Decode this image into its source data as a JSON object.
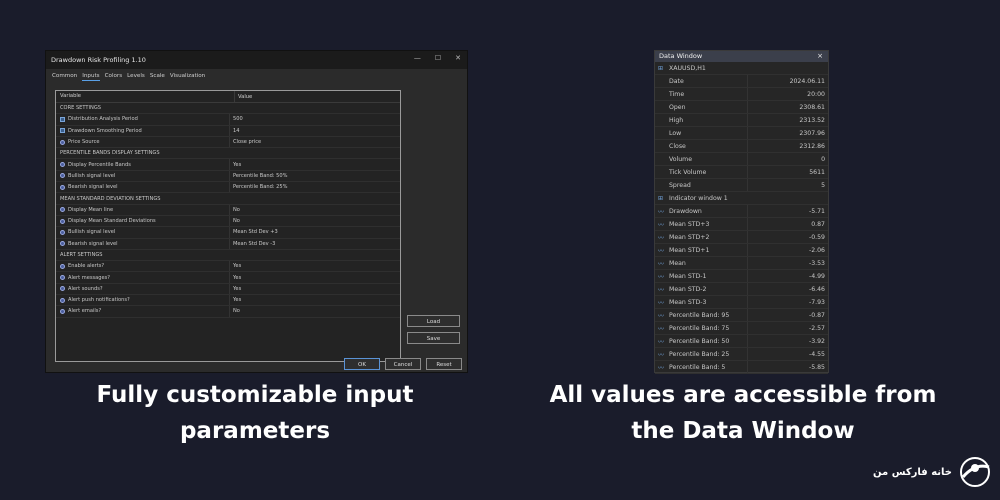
{
  "dialog": {
    "title": "Drawdown Risk Profiling 1.10",
    "tabs": [
      "Common",
      "Inputs",
      "Colors",
      "Levels",
      "Scale",
      "Visualization"
    ],
    "active_tab": "Inputs",
    "headers": {
      "variable": "Variable",
      "value": "Value"
    },
    "rows": [
      {
        "type": "section",
        "label": "CORE SETTINGS"
      },
      {
        "type": "param",
        "icon": "num",
        "label": "Distribution Analysis Period",
        "value": "500"
      },
      {
        "type": "param",
        "icon": "num",
        "label": "Drawdown Smoothing Period",
        "value": "14"
      },
      {
        "type": "param",
        "icon": "opt",
        "label": "Price Source",
        "value": "Close price"
      },
      {
        "type": "section",
        "label": "PERCENTILE BANDS DISPLAY SETTINGS"
      },
      {
        "type": "param",
        "icon": "opt",
        "label": "Display Percentile Bands",
        "value": "Yes"
      },
      {
        "type": "param",
        "icon": "opt",
        "label": "Bullish signal level",
        "value": "Percentile Band: 50%"
      },
      {
        "type": "param",
        "icon": "opt",
        "label": "Bearish signal level",
        "value": "Percentile Band: 25%"
      },
      {
        "type": "section",
        "label": "MEAN STANDARD DEVIATION SETTINGS"
      },
      {
        "type": "param",
        "icon": "opt",
        "label": "Display Mean line",
        "value": "No"
      },
      {
        "type": "param",
        "icon": "opt",
        "label": "Display Mean Standard Deviations",
        "value": "No"
      },
      {
        "type": "param",
        "icon": "opt",
        "label": "Bullish signal level",
        "value": "Mean Std Dev +3"
      },
      {
        "type": "param",
        "icon": "opt",
        "label": "Bearish signal level",
        "value": "Mean Std Dev -3"
      },
      {
        "type": "section",
        "label": "ALERT SETTINGS"
      },
      {
        "type": "param",
        "icon": "opt",
        "label": "Enable alerts?",
        "value": "Yes"
      },
      {
        "type": "param",
        "icon": "opt",
        "label": "Alert messages?",
        "value": "Yes"
      },
      {
        "type": "param",
        "icon": "opt",
        "label": "Alert sounds?",
        "value": "Yes"
      },
      {
        "type": "param",
        "icon": "opt",
        "label": "Alert push notifications?",
        "value": "Yes"
      },
      {
        "type": "param",
        "icon": "opt",
        "label": "Alert emails?",
        "value": "No"
      }
    ],
    "buttons": {
      "load": "Load",
      "save": "Save",
      "ok": "OK",
      "cancel": "Cancel",
      "reset": "Reset"
    }
  },
  "data_window": {
    "title": "Data Window",
    "close": "×",
    "rows": [
      {
        "type": "group",
        "icon": "chart-icon",
        "label": "XAUUSD,H1"
      },
      {
        "type": "item",
        "label": "Date",
        "value": "2024.06.11"
      },
      {
        "type": "item",
        "label": "Time",
        "value": "20:00"
      },
      {
        "type": "item",
        "label": "Open",
        "value": "2308.61"
      },
      {
        "type": "item",
        "label": "High",
        "value": "2313.52"
      },
      {
        "type": "item",
        "label": "Low",
        "value": "2307.96"
      },
      {
        "type": "item",
        "label": "Close",
        "value": "2312.86"
      },
      {
        "type": "item",
        "label": "Volume",
        "value": "0"
      },
      {
        "type": "item",
        "label": "Tick Volume",
        "value": "5611"
      },
      {
        "type": "item",
        "label": "Spread",
        "value": "5"
      },
      {
        "type": "group",
        "icon": "indicator-icon",
        "label": "Indicator window 1"
      },
      {
        "type": "line",
        "label": "Drawdown",
        "value": "-5.71"
      },
      {
        "type": "line",
        "label": "Mean STD+3",
        "value": "0.87"
      },
      {
        "type": "line",
        "label": "Mean STD+2",
        "value": "-0.59"
      },
      {
        "type": "line",
        "label": "Mean STD+1",
        "value": "-2.06"
      },
      {
        "type": "line",
        "label": "Mean",
        "value": "-3.53"
      },
      {
        "type": "line",
        "label": "Mean STD-1",
        "value": "-4.99"
      },
      {
        "type": "line",
        "label": "Mean STD-2",
        "value": "-6.46"
      },
      {
        "type": "line",
        "label": "Mean STD-3",
        "value": "-7.93"
      },
      {
        "type": "line",
        "label": "Percentile Band: 95",
        "value": "-0.87"
      },
      {
        "type": "line",
        "label": "Percentile Band: 75",
        "value": "-2.57"
      },
      {
        "type": "line",
        "label": "Percentile Band: 50",
        "value": "-3.92"
      },
      {
        "type": "line",
        "label": "Percentile Band: 25",
        "value": "-4.55"
      },
      {
        "type": "line",
        "label": "Percentile Band: 5",
        "value": "-5.85"
      }
    ]
  },
  "captions": {
    "left_line1": "Fully customizable input",
    "left_line2": "parameters",
    "right_line1": "All values are accessible from",
    "right_line2": "the Data Window"
  },
  "logo": {
    "text": "خانه فارکس من"
  }
}
